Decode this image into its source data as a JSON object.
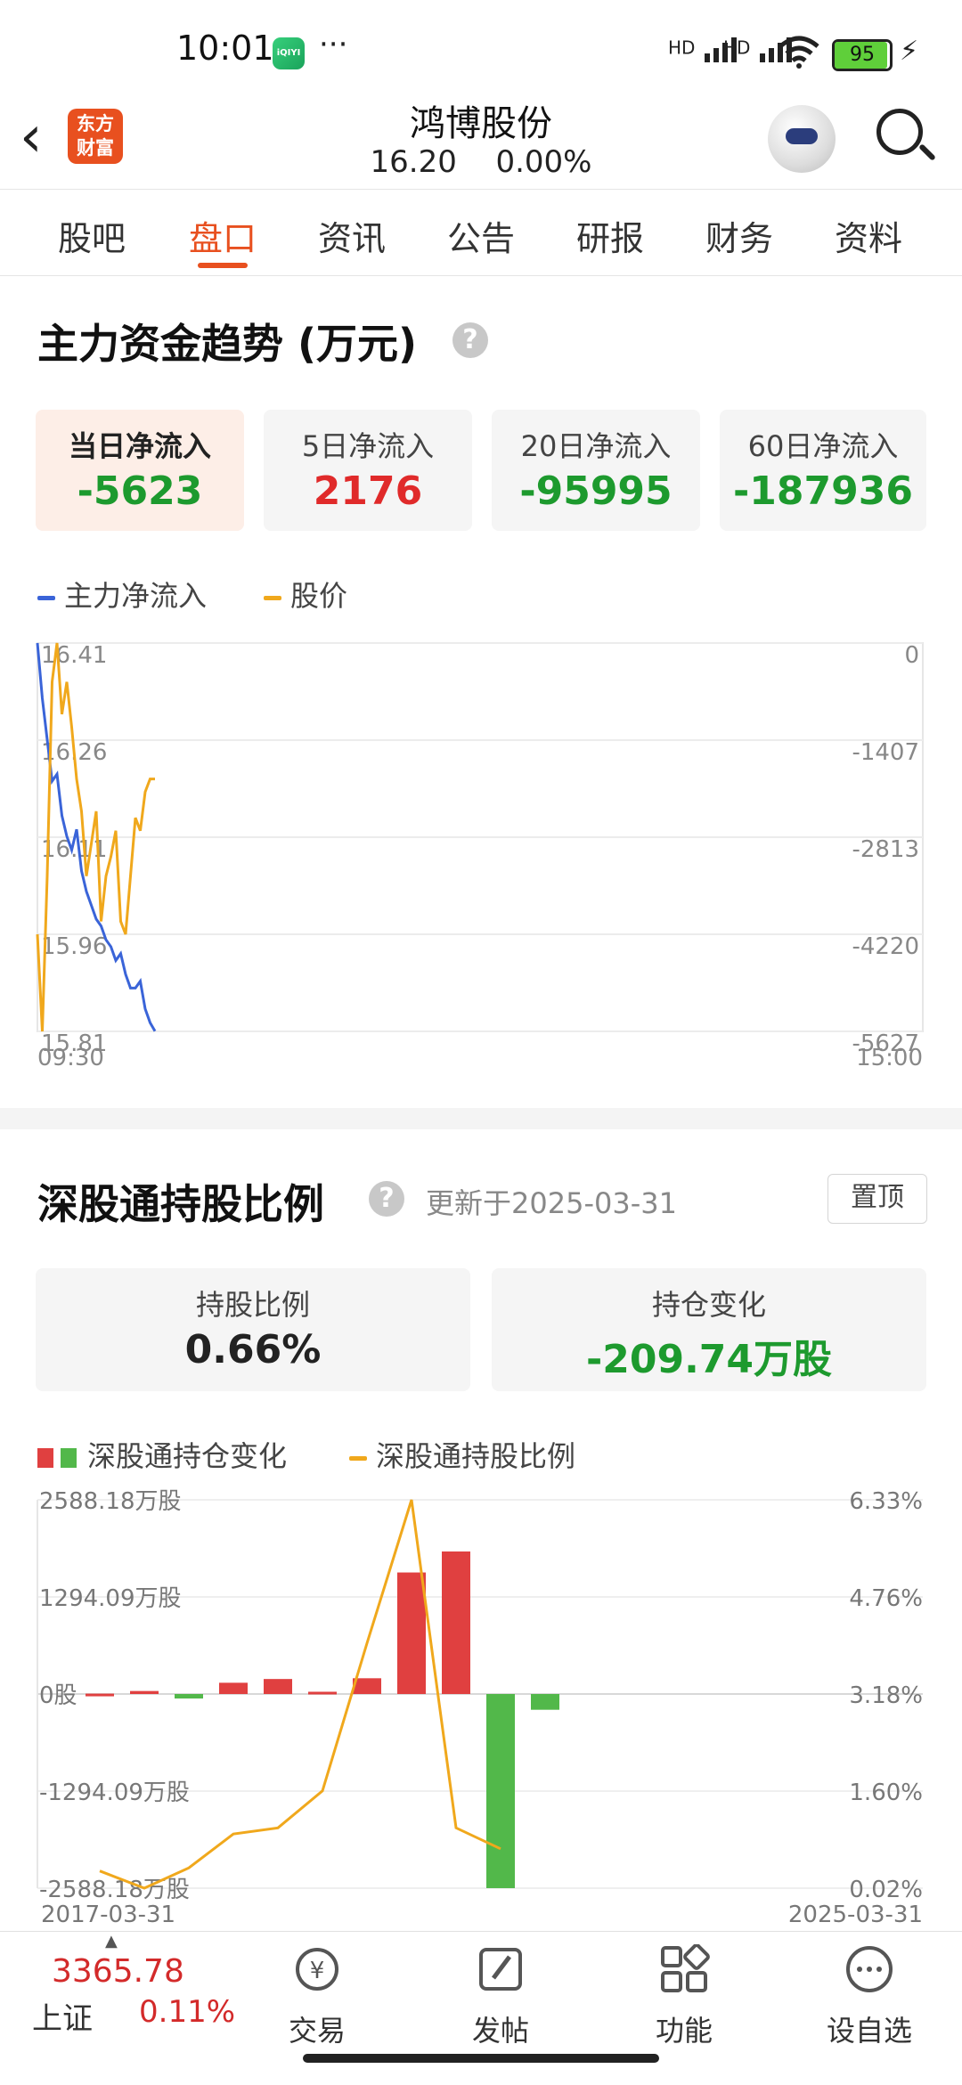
{
  "status_bar": {
    "time": "10:01",
    "app_icon_label": "iQIYI",
    "more": "···",
    "sig1": "HD",
    "sig2": "HD",
    "battery": "95",
    "battery_pct": 0.95
  },
  "header": {
    "logo_line1": "东方",
    "logo_line2": "财富",
    "stock_name": "鸿博股份",
    "price": "16.20",
    "change": "0.00%"
  },
  "tabs": [
    {
      "label": "股吧"
    },
    {
      "label": "盘口"
    },
    {
      "label": "资讯"
    },
    {
      "label": "公告"
    },
    {
      "label": "研报"
    },
    {
      "label": "财务"
    },
    {
      "label": "资料"
    }
  ],
  "active_tab": 1,
  "fund_trend": {
    "title": "主力资金趋势 (万元)",
    "help": "?",
    "cards": [
      {
        "label": "当日净流入",
        "value": "-5623",
        "color": "#1d9a2e"
      },
      {
        "label": "5日净流入",
        "value": "2176",
        "color": "#e02a2a"
      },
      {
        "label": "20日净流入",
        "value": "-95995",
        "color": "#1d9a2e"
      },
      {
        "label": "60日净流入",
        "value": "-187936",
        "color": "#1d9a2e"
      }
    ],
    "legend": [
      {
        "name": "主力净流入",
        "color": "#3a64d8"
      },
      {
        "name": "股价",
        "color": "#f0a81c"
      }
    ]
  },
  "holding": {
    "title": "深股通持股比例",
    "help": "?",
    "update": "更新于2025-03-31",
    "pin": "置顶",
    "cards": [
      {
        "label": "持股比例",
        "value": "0.66%",
        "color": "#222222"
      },
      {
        "label": "持仓变化",
        "value": "-209.74万股",
        "color": "#1d9a2e"
      }
    ],
    "legend_bar": "深股通持仓变化",
    "legend_line": "深股通持股比例"
  },
  "chart_data": [
    {
      "type": "line",
      "x_start": "09:30",
      "x_end": "15:00",
      "left_axis_ticks": [
        "16.41",
        "16.26",
        "16.11",
        "15.96",
        "15.81"
      ],
      "right_axis_ticks": [
        "0",
        "-1407",
        "-2813",
        "-4220",
        "-5627"
      ],
      "series": [
        {
          "name": "主力净流入",
          "axis": "right",
          "values": [
            0,
            -800,
            -1400,
            -2000,
            -1900,
            -2500,
            -2800,
            -3000,
            -2700,
            -3300,
            -3600,
            -3800,
            -4000,
            -4100,
            -4300,
            -4400,
            -4600,
            -4500,
            -4800,
            -5000,
            -5000,
            -4900,
            -5300,
            -5500,
            -5623
          ]
        },
        {
          "name": "股价",
          "axis": "left",
          "values": [
            15.96,
            15.81,
            16.05,
            16.35,
            16.41,
            16.3,
            16.35,
            16.28,
            16.2,
            16.15,
            16.05,
            16.1,
            16.15,
            15.98,
            16.05,
            16.08,
            16.12,
            15.98,
            15.96,
            16.05,
            16.14,
            16.12,
            16.18,
            16.2,
            16.2
          ]
        }
      ]
    },
    {
      "type": "bar",
      "x_start": "2017-03-31",
      "x_end": "2025-03-31",
      "left_axis_ticks": [
        "2588.18万股",
        "1294.09万股",
        "0股",
        "-1294.09万股",
        "-2588.18万股"
      ],
      "right_axis_ticks": [
        "6.33%",
        "4.76%",
        "3.18%",
        "1.60%",
        "0.02%"
      ],
      "ylim_left": [
        -2588.18,
        2588.18
      ],
      "ylim_right": [
        0.02,
        6.33
      ],
      "bars": [
        5,
        40,
        -60,
        150,
        200,
        30,
        210,
        1620,
        1900,
        -2588,
        -210
      ],
      "ratio": [
        0.3,
        0.02,
        0.35,
        0.9,
        1.0,
        1.6,
        4.0,
        6.33,
        1.0,
        0.66
      ]
    }
  ],
  "bottom_nav": {
    "index_value": "3365.78",
    "index_name": "上证",
    "index_change": "0.11%",
    "items": [
      {
        "label": "交易"
      },
      {
        "label": "发帖"
      },
      {
        "label": "功能"
      },
      {
        "label": "设自选"
      }
    ]
  }
}
